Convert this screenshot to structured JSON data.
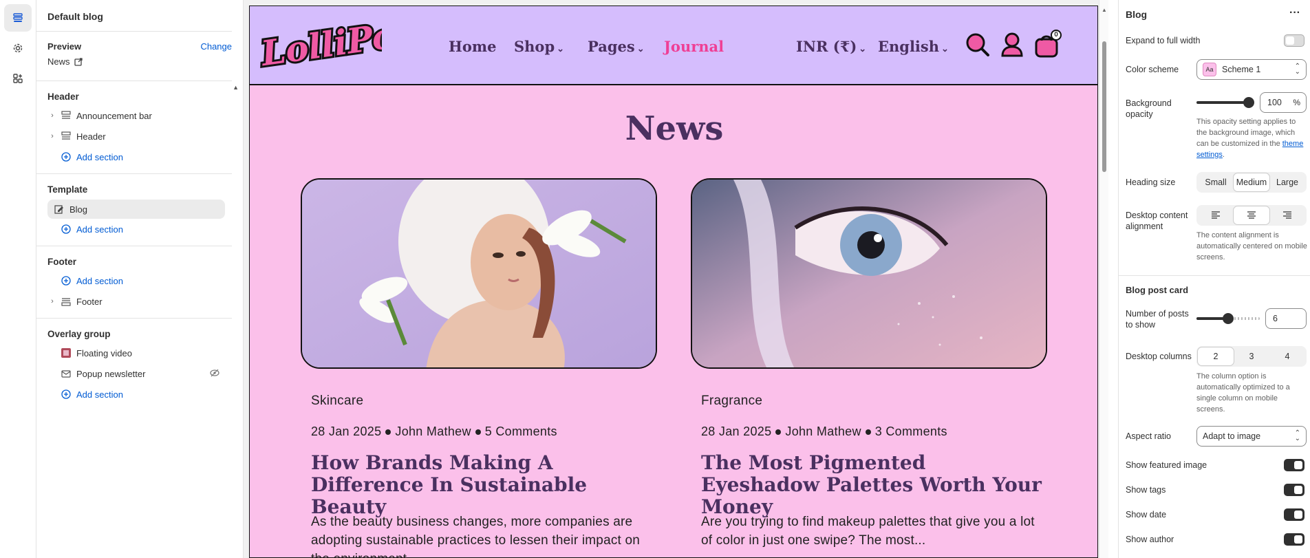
{
  "left_panel": {
    "title": "Default blog",
    "preview_label": "Preview",
    "change_link": "Change",
    "preview_page": "News",
    "header_group": {
      "label": "Header",
      "items": [
        "Announcement bar",
        "Header"
      ],
      "add_section": "Add section"
    },
    "template_group": {
      "label": "Template",
      "items": [
        "Blog"
      ],
      "add_section": "Add section"
    },
    "footer_group": {
      "label": "Footer",
      "add_section": "Add section",
      "items": [
        "Footer"
      ]
    },
    "overlay_group": {
      "label": "Overlay group",
      "items": [
        "Floating video",
        "Popup newsletter"
      ],
      "add_section": "Add section"
    }
  },
  "store": {
    "logo_text": "LolliPop",
    "nav": [
      "Home",
      "Shop",
      "Pages",
      "Journal"
    ],
    "currency": "INR (₹)",
    "language": "English",
    "cart_count": "0",
    "page_title": "News",
    "posts": [
      {
        "category": "Skincare",
        "date": "28 Jan 2025",
        "author": "John Mathew",
        "comments": "5 Comments",
        "title": "How Brands Making A Difference In Sustainable Beauty",
        "excerpt": "As the beauty business changes, more companies are adopting sustainable practices to lessen their impact on the environment."
      },
      {
        "category": "Fragrance",
        "date": "28 Jan 2025",
        "author": "John Mathew",
        "comments": "3 Comments",
        "title": "The Most Pigmented Eyeshadow Palettes Worth Your Money",
        "excerpt": "Are you trying to find makeup palettes that give you a lot of color in just one swipe? The most..."
      }
    ]
  },
  "settings": {
    "title": "Blog",
    "expand_full_width": "Expand to full width",
    "expand_full_width_on": false,
    "color_scheme_label": "Color scheme",
    "color_scheme_value": "Scheme 1",
    "color_scheme_swatch": "Aa",
    "bg_opacity_label": "Background opacity",
    "bg_opacity_value": "100",
    "bg_opacity_unit": "%",
    "bg_opacity_help": "This opacity setting applies to the background image, which can be customized in the",
    "bg_opacity_link": "theme settings",
    "heading_size_label": "Heading size",
    "heading_sizes": [
      "Small",
      "Medium",
      "Large"
    ],
    "heading_size_selected": "Medium",
    "content_alignment_label": "Desktop content alignment",
    "content_alignment_selected": "center",
    "content_alignment_help": "The content alignment is automatically centered on mobile screens.",
    "blog_post_card_heading": "Blog post card",
    "posts_to_show_label": "Number of posts to show",
    "posts_to_show_value": "6",
    "posts_to_show_fraction": 0.45,
    "desktop_columns_label": "Desktop columns",
    "desktop_columns": [
      "2",
      "3",
      "4"
    ],
    "desktop_columns_selected": "2",
    "desktop_columns_help": "The column option is automatically optimized to a single column on mobile screens.",
    "aspect_ratio_label": "Aspect ratio",
    "aspect_ratio_value": "Adapt to image",
    "toggles": [
      {
        "label": "Show featured image",
        "on": true
      },
      {
        "label": "Show tags",
        "on": true
      },
      {
        "label": "Show date",
        "on": true
      },
      {
        "label": "Show author",
        "on": true
      }
    ]
  },
  "colors": {
    "header_bg": "#d5bdfd",
    "page_bg": "#fbc0ea",
    "heading": "#4a3060",
    "accent": "#ef3f95",
    "link": "#005bd3"
  }
}
